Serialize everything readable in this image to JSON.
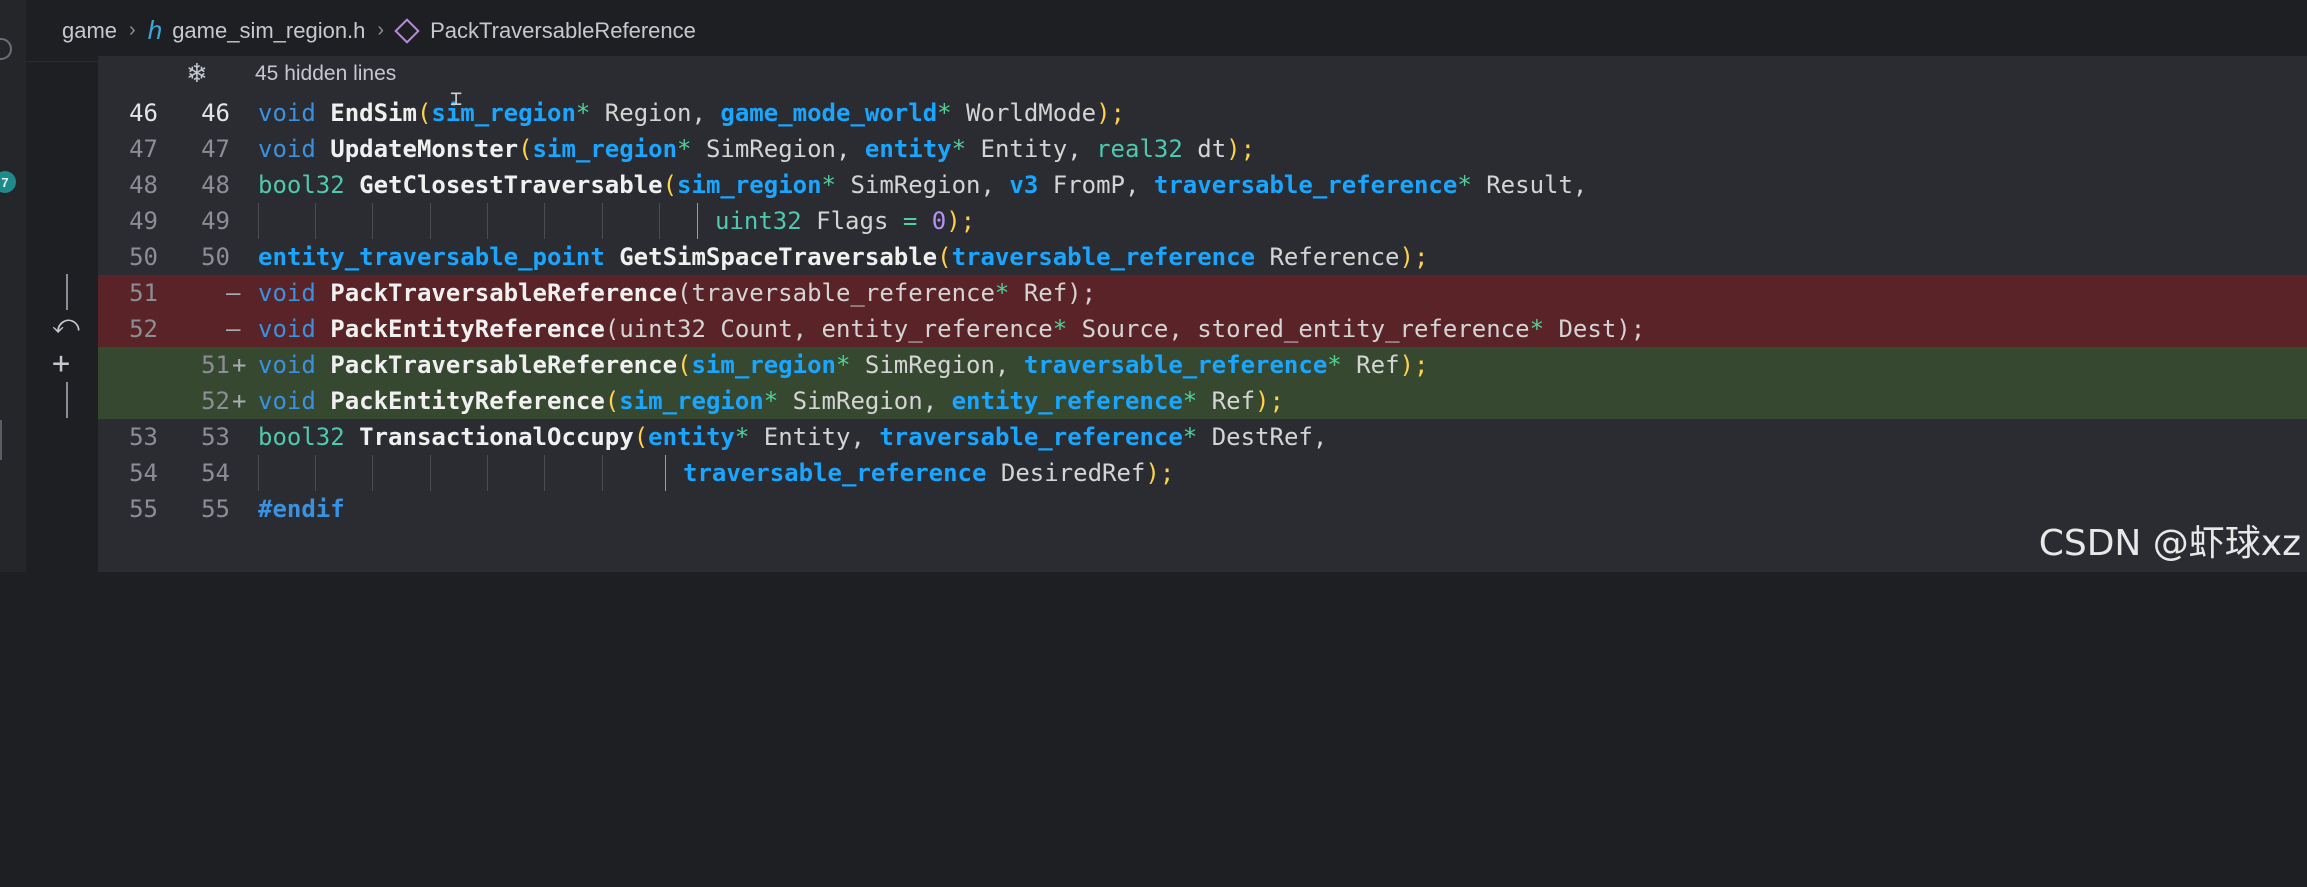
{
  "breadcrumb": {
    "folder": "game",
    "file": "game_sim_region.h",
    "symbol": "PackTraversableReference"
  },
  "activity_badge": "7",
  "hidden_lines_label": "45 hidden lines",
  "lines": [
    {
      "old": "46",
      "new": "46"
    },
    {
      "old": "47",
      "new": "47"
    },
    {
      "old": "48",
      "new": "48"
    },
    {
      "old": "49",
      "new": "49"
    },
    {
      "old": "50",
      "new": "50"
    },
    {
      "old": "51",
      "new": "",
      "marker": "—"
    },
    {
      "old": "52",
      "new": "",
      "marker": "—"
    },
    {
      "old": "",
      "new": "51",
      "marker": "+"
    },
    {
      "old": "",
      "new": "52",
      "marker": "+"
    },
    {
      "old": "53",
      "new": "53"
    },
    {
      "old": "54",
      "new": "54"
    },
    {
      "old": "55",
      "new": "55"
    }
  ],
  "code": {
    "l46": [
      "void",
      "EndSim",
      "(",
      "sim_region",
      "*",
      " Region, ",
      "game_mode_world",
      "*",
      " WorldMode",
      ");"
    ],
    "l47": [
      "void",
      "UpdateMonster",
      "(",
      "sim_region",
      "*",
      " SimRegion, ",
      "entity",
      "*",
      " Entity, ",
      "real32",
      " dt",
      ");"
    ],
    "l48": [
      "bool32",
      "GetClosestTraversable",
      "(",
      "sim_region",
      "*",
      " SimRegion, ",
      "v3",
      " FromP, ",
      "traversable_reference",
      "*",
      " Result,"
    ],
    "l49": [
      "uint32",
      " Flags ",
      "=",
      " 0",
      ");"
    ],
    "l50": [
      "entity_traversable_point",
      "GetSimSpaceTraversable",
      "(",
      "traversable_reference",
      " Reference",
      ");"
    ],
    "l51d": [
      "void",
      "PackTraversableReference",
      "(traversable_reference",
      "*",
      " Ref);"
    ],
    "l52d": [
      "void",
      "PackEntityReference",
      "(uint32 Count, entity_reference",
      "*",
      " Source, stored_entity_reference",
      "*",
      " Dest);"
    ],
    "l51a": [
      "void",
      "PackTraversableReference",
      "(",
      "sim_region",
      "*",
      " SimRegion, ",
      "traversable_reference",
      "*",
      " Ref",
      ");"
    ],
    "l52a": [
      "void",
      "PackEntityReference",
      "(",
      "sim_region",
      "*",
      " SimRegion, ",
      "entity_reference",
      "*",
      " Ref",
      ");"
    ],
    "l53": [
      "bool32",
      "TransactionalOccupy",
      "(",
      "entity",
      "*",
      " Entity, ",
      "traversable_reference",
      "*",
      " DestRef,"
    ],
    "l54": [
      "traversable_reference",
      " DesiredRef",
      ");"
    ],
    "l55": [
      "#endif"
    ]
  },
  "watermark": "CSDN @虾球xz",
  "colors": {
    "deleted_bg": "#5a2327",
    "added_bg": "#374830",
    "keyword": "#3a91e0",
    "type": "#1aa6ff",
    "paren": "#ffd24d"
  },
  "icons": [
    "h-file-icon",
    "symbol-icon",
    "unfold-icon",
    "revert-icon",
    "plus-icon",
    "cursor-icon"
  ]
}
